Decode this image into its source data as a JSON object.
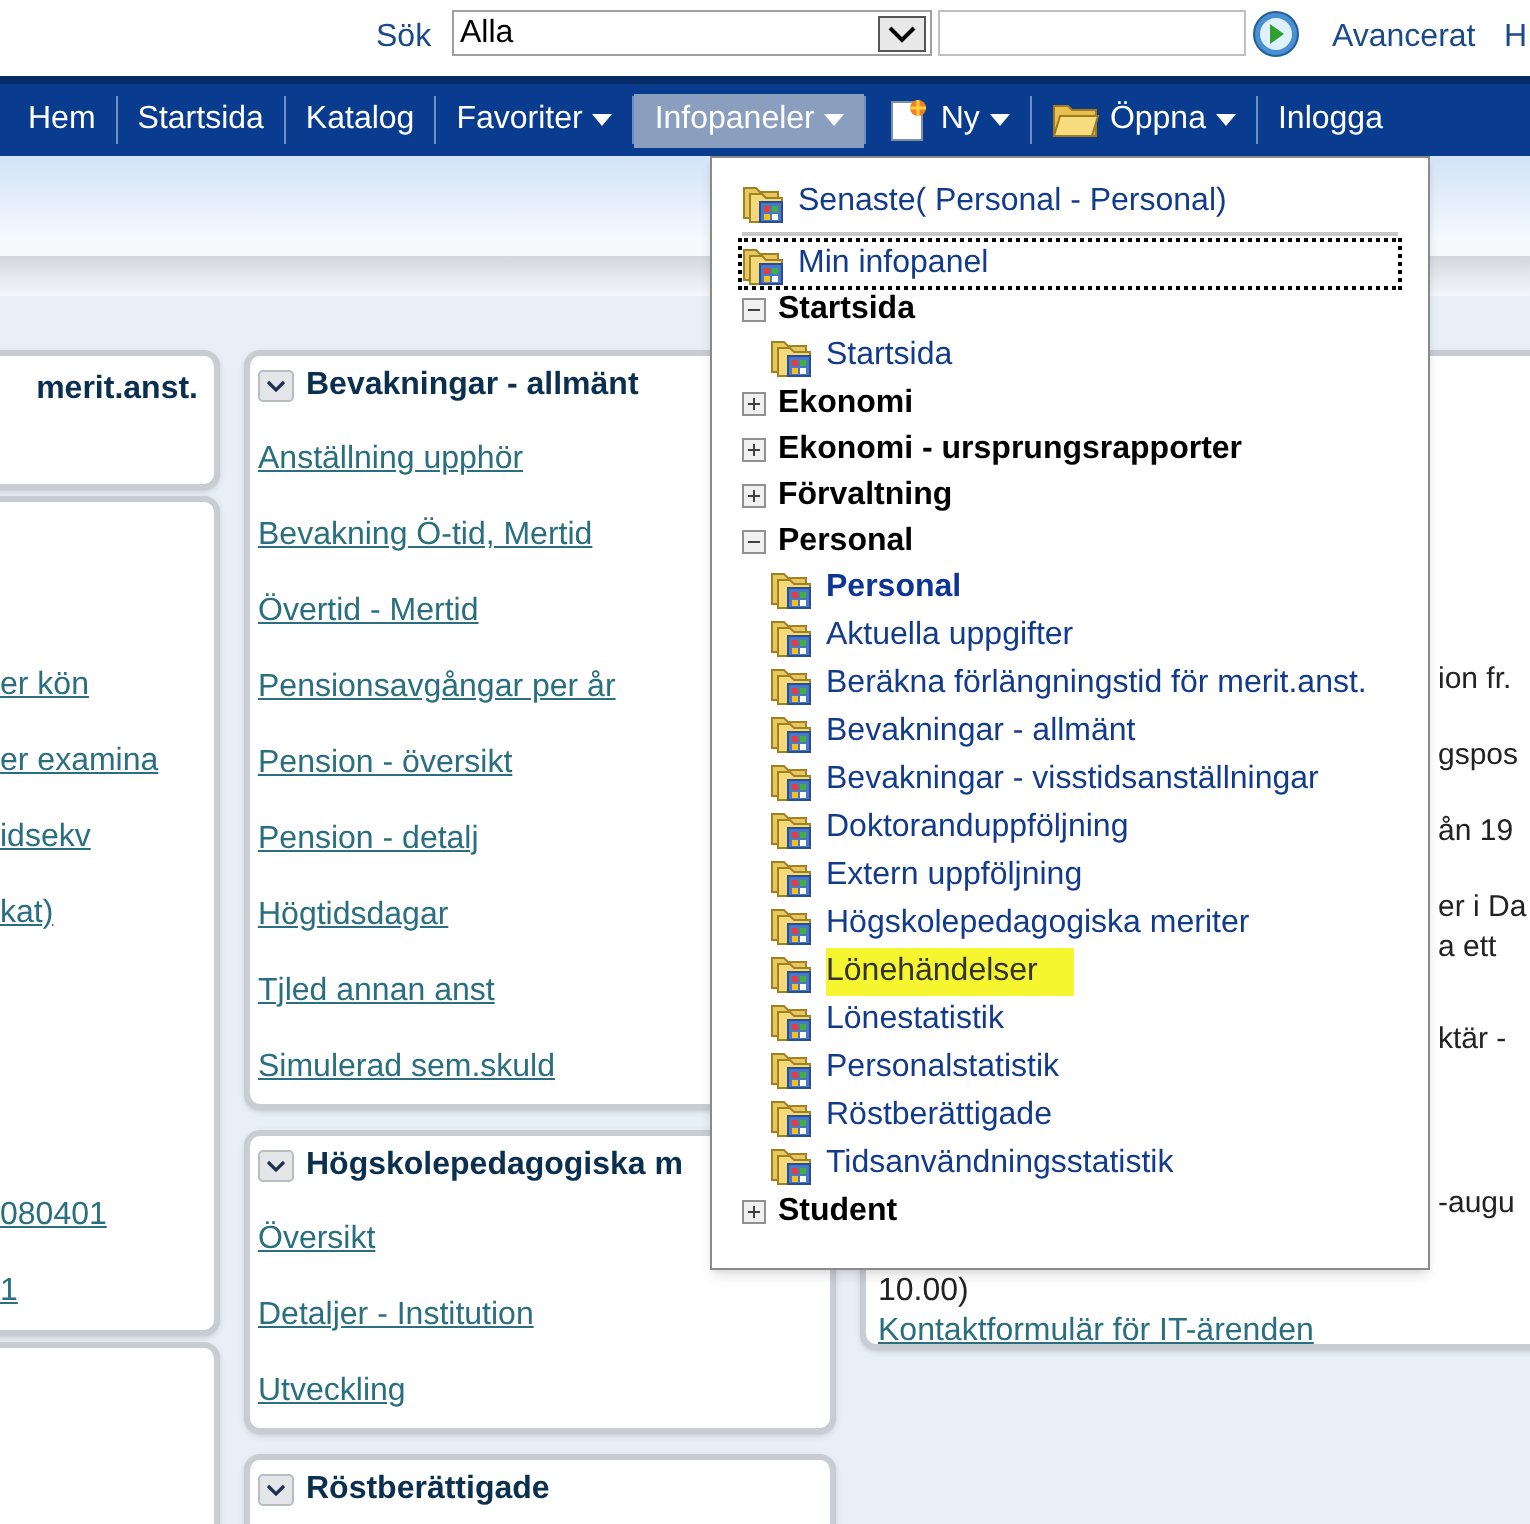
{
  "search": {
    "label": "Sök",
    "scope": "Alla",
    "advanced_link": "Avancerat",
    "cut_link": "H"
  },
  "nav": [
    {
      "label": "Hem",
      "kind": "plain",
      "dropdown": false,
      "selected": false
    },
    {
      "label": "Startsida",
      "kind": "plain",
      "dropdown": false,
      "selected": false
    },
    {
      "label": "Katalog",
      "kind": "plain",
      "dropdown": false,
      "selected": false
    },
    {
      "label": "Favoriter",
      "kind": "plain",
      "dropdown": true,
      "selected": false
    },
    {
      "label": "Infopaneler",
      "kind": "plain",
      "dropdown": true,
      "selected": true
    },
    {
      "label": "Ny",
      "kind": "new",
      "dropdown": true,
      "selected": false
    },
    {
      "label": "Öppna",
      "kind": "folder",
      "dropdown": true,
      "selected": false
    },
    {
      "label": "Inlogga",
      "kind": "plain",
      "dropdown": false,
      "selected": false
    }
  ],
  "left_column": [
    {
      "title": "merit.anst."
    },
    {
      "links": [
        "er kön",
        "er examina",
        "idsekv",
        "kat)",
        "080401",
        "1"
      ]
    }
  ],
  "middle_column": [
    {
      "title": "Bevakningar - allmänt",
      "links": [
        "Anställning upphör",
        "Bevakning Ö-tid, Mertid",
        "Övertid - Mertid",
        "Pensionsavgångar per år",
        "Pension - översikt",
        "Pension - detalj",
        "Högtidsdagar",
        "Tjled annan anst",
        "Simulerad sem.skuld"
      ]
    },
    {
      "title": "Högskolepedagogiska m",
      "links": [
        "Översikt",
        "Detaljer - Institution",
        "Utveckling"
      ]
    },
    {
      "title": "Röstberättigade"
    }
  ],
  "right_panel": {
    "fragments": [
      "ion fr.",
      "gspos",
      "ån 19",
      "er i Da",
      "a ett",
      "ktär -",
      "-augu",
      "10.00)"
    ],
    "link": "Kontaktformulär för IT-ärenden"
  },
  "infopanel_menu": {
    "recent": "Senaste( Personal - Personal)",
    "focused_item": {
      "label": "Min infopanel",
      "focused": true
    },
    "groups": [
      {
        "label": "Startsida",
        "expanded": true,
        "children": [
          {
            "label": "Startsida",
            "selected": false,
            "highlighted": false
          }
        ]
      },
      {
        "label": "Ekonomi",
        "expanded": false
      },
      {
        "label": "Ekonomi - ursprungsrapporter",
        "expanded": false
      },
      {
        "label": "Förvaltning",
        "expanded": false
      },
      {
        "label": "Personal",
        "expanded": true,
        "children": [
          {
            "label": "Personal",
            "selected": true,
            "highlighted": false
          },
          {
            "label": "Aktuella uppgifter",
            "selected": false,
            "highlighted": false
          },
          {
            "label": "Beräkna förlängningstid för merit.anst.",
            "selected": false,
            "highlighted": false
          },
          {
            "label": "Bevakningar - allmänt",
            "selected": false,
            "highlighted": false
          },
          {
            "label": "Bevakningar - visstidsanställningar",
            "selected": false,
            "highlighted": false
          },
          {
            "label": "Doktoranduppföljning",
            "selected": false,
            "highlighted": false
          },
          {
            "label": "Extern uppföljning",
            "selected": false,
            "highlighted": false
          },
          {
            "label": "Högskolepedagogiska meriter",
            "selected": false,
            "highlighted": false
          },
          {
            "label": "Lönehändelser",
            "selected": false,
            "highlighted": true
          },
          {
            "label": "Lönestatistik",
            "selected": false,
            "highlighted": false
          },
          {
            "label": "Personalstatistik",
            "selected": false,
            "highlighted": false
          },
          {
            "label": "Röstberättigade",
            "selected": false,
            "highlighted": false
          },
          {
            "label": "Tidsanvändningsstatistik",
            "selected": false,
            "highlighted": false
          }
        ]
      },
      {
        "label": "Student",
        "expanded": false
      }
    ]
  }
}
